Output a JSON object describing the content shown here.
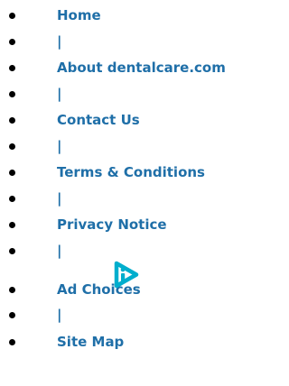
{
  "footer": {
    "links": [
      {
        "label": "Home"
      },
      {
        "label": "|"
      },
      {
        "label": "About dentalcare.com"
      },
      {
        "label": "|"
      },
      {
        "label": "Contact Us"
      },
      {
        "label": "|"
      },
      {
        "label": "Terms & Conditions"
      },
      {
        "label": "|"
      },
      {
        "label": "Privacy Notice"
      },
      {
        "label": "|"
      },
      {
        "label": "Ad Choices"
      },
      {
        "label": "|"
      },
      {
        "label": "Site Map"
      }
    ],
    "link_color": "#1f6fa8",
    "adchoices_icon": "adchoices-icon"
  }
}
